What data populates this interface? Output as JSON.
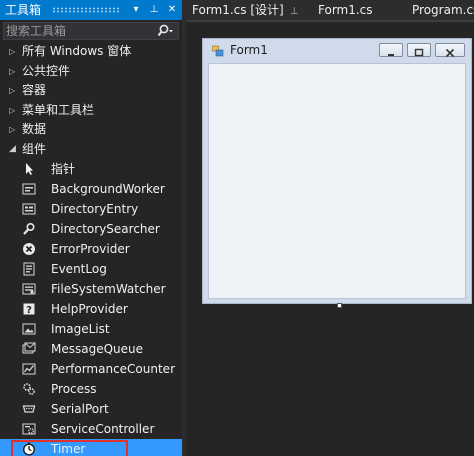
{
  "toolbox": {
    "title": "工具箱",
    "pin_glyph": "▾",
    "autohide_glyph": "⊥",
    "close_glyph": "✕",
    "search": {
      "placeholder": "搜索工具箱",
      "value": ""
    },
    "categories": [
      {
        "label": "所有 Windows 窗体",
        "expanded": false
      },
      {
        "label": "公共控件",
        "expanded": false
      },
      {
        "label": "容器",
        "expanded": false
      },
      {
        "label": "菜单和工具栏",
        "expanded": false
      },
      {
        "label": "数据",
        "expanded": false
      },
      {
        "label": "组件",
        "expanded": true
      }
    ],
    "components": [
      {
        "label": "指针",
        "icon": "pointer-icon"
      },
      {
        "label": "BackgroundWorker",
        "icon": "background-worker-icon"
      },
      {
        "label": "DirectoryEntry",
        "icon": "directory-entry-icon"
      },
      {
        "label": "DirectorySearcher",
        "icon": "directory-searcher-icon"
      },
      {
        "label": "ErrorProvider",
        "icon": "error-provider-icon"
      },
      {
        "label": "EventLog",
        "icon": "event-log-icon"
      },
      {
        "label": "FileSystemWatcher",
        "icon": "file-system-watcher-icon"
      },
      {
        "label": "HelpProvider",
        "icon": "help-provider-icon"
      },
      {
        "label": "ImageList",
        "icon": "image-list-icon"
      },
      {
        "label": "MessageQueue",
        "icon": "message-queue-icon"
      },
      {
        "label": "PerformanceCounter",
        "icon": "performance-counter-icon"
      },
      {
        "label": "Process",
        "icon": "process-icon"
      },
      {
        "label": "SerialPort",
        "icon": "serial-port-icon"
      },
      {
        "label": "ServiceController",
        "icon": "service-controller-icon"
      },
      {
        "label": "Timer",
        "icon": "timer-icon",
        "selected": true
      }
    ]
  },
  "document_tabs": [
    {
      "label": "Form1.cs [设计]",
      "pin": "⊥",
      "active": true
    },
    {
      "label": "Form1.cs",
      "active": false
    },
    {
      "label": "Program.cs",
      "active": false
    }
  ],
  "designer": {
    "form_title": "Form1"
  },
  "colors": {
    "accent": "#007acc",
    "selection": "#3399ff",
    "highlight_outline": "#e03030",
    "panel_bg": "#252526"
  }
}
